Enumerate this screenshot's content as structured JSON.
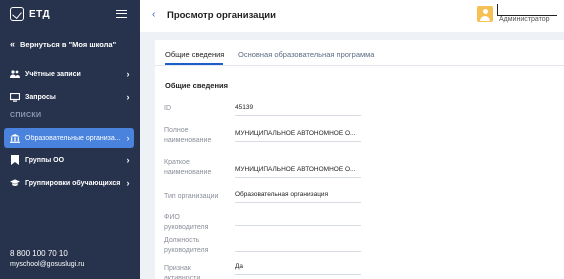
{
  "app": {
    "logo_text": "ЕТД"
  },
  "sidebar": {
    "back_label": "Вернуться в \"Моя школа\"",
    "items": [
      {
        "label": "Учётные записи"
      },
      {
        "label": "Запросы"
      }
    ],
    "section_label": "СПИСКИ",
    "list_items": [
      {
        "label": "Образовательные организа...",
        "active": true
      },
      {
        "label": "Группы ОО"
      },
      {
        "label": "Группировки обучающихся"
      }
    ],
    "contacts": {
      "phone": "8 800 100 70 10",
      "email": "myschool@gosuslugi.ru"
    }
  },
  "header": {
    "title": "Просмотр организации",
    "user_role": "Администратор"
  },
  "tabs": [
    {
      "label": "Общие сведения",
      "active": true
    },
    {
      "label": "Основная образовательная программа"
    }
  ],
  "section_title": "Общие сведения",
  "fields": [
    {
      "label": "ID",
      "value": "45139"
    },
    {
      "label": "Полное наименование",
      "value": "МУНИЦИПАЛЬНОЕ АВТОНОМНОЕ О..."
    },
    {
      "label": "Краткое наименование",
      "value": "МУНИЦИПАЛЬНОЕ АВТОНОМНОЕ О..."
    },
    {
      "label": "Тип организации",
      "value": "Образовательная организация"
    },
    {
      "label": "ФИО руководителя",
      "value": ""
    },
    {
      "label": "Должность руководителя",
      "value": ""
    },
    {
      "label": "Признак активности",
      "value": "Да"
    }
  ],
  "colors": {
    "sidebar_bg": "#27334d",
    "accent": "#4a83de",
    "link": "#1d5ec8",
    "avatar": "#f7c055"
  }
}
